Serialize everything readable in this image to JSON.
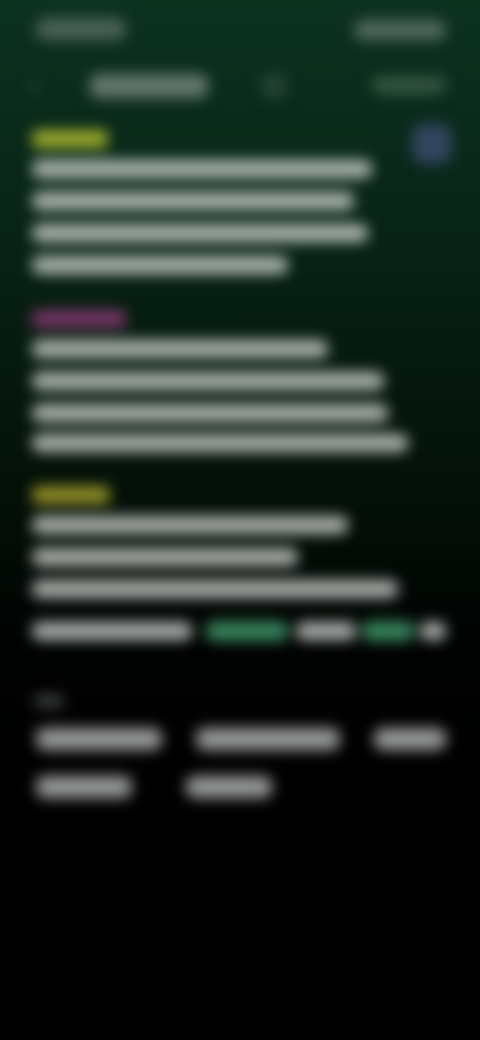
{
  "status_bar": {
    "time": "",
    "icons": ""
  },
  "header": {
    "back_icon": "back-arrow-icon",
    "title": "",
    "action_label": ""
  },
  "sections": [
    {
      "tag": "",
      "tag_color": "#b6c230"
    },
    {
      "tag": "",
      "tag_color": "#8a3a74"
    },
    {
      "tag": "",
      "tag_color": "#a9a52a"
    }
  ],
  "accent_colors": {
    "background_top": "#0c3220",
    "link": "#3f9a6b"
  },
  "chips": [
    "",
    "",
    "",
    "",
    ""
  ]
}
